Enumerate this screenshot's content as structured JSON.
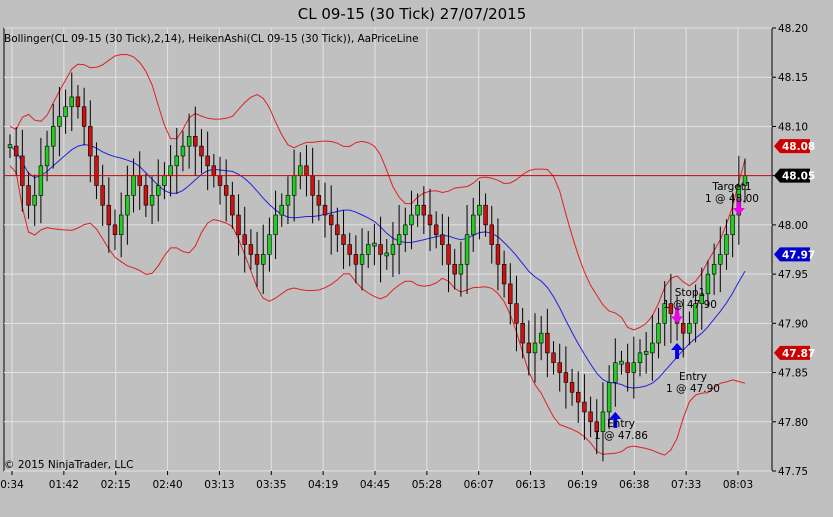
{
  "chart_data": {
    "type": "candlestick",
    "title": "CL 09-15 (30 Tick)  27/07/2015",
    "indicator_label": "Bollinger(CL 09-15 (30 Tick),2,14), HeikenAshi(CL 09-15 (30 Tick)), AaPriceLine",
    "copyright": "© 2015 NinjaTrader, LLC",
    "ylim": [
      47.75,
      48.2
    ],
    "y_ticks": [
      "48.20",
      "48.15",
      "48.10",
      "48.05",
      "48.00",
      "47.95",
      "47.90",
      "47.85",
      "47.80",
      "47.75"
    ],
    "x_ticks": [
      "0:34",
      "01:42",
      "02:15",
      "02:40",
      "03:13",
      "03:35",
      "04:19",
      "04:45",
      "05:28",
      "06:07",
      "06:13",
      "06:19",
      "06:38",
      "07:33",
      "08:03"
    ],
    "grid": true,
    "colors": {
      "up": "#22cc22",
      "down": "#cc1111",
      "band": "#dd2222",
      "mid": "#2222dd",
      "price_line": "#cc0000",
      "background": "#c0c0c0"
    },
    "price_tags": [
      {
        "value": 48.08,
        "label": "48.08",
        "color": "#cc0000"
      },
      {
        "value": 48.05,
        "label": "48.05",
        "color": "#000000"
      },
      {
        "value": 47.97,
        "label": "47.97",
        "color": "#0000cc"
      },
      {
        "value": 47.87,
        "label": "47.87",
        "color": "#cc0000"
      }
    ],
    "price_line": 48.05,
    "annotations": [
      {
        "label": "Target1",
        "qty": "1 @ 48.00",
        "marker": "exit-arrow-down"
      },
      {
        "label": "Stop1",
        "qty": "1 @ 47.90",
        "marker": "exit-arrow-down"
      },
      {
        "label": "Entry",
        "qty": "1 @ 47.90",
        "marker": "entry-arrow-up"
      },
      {
        "label": "Entry",
        "qty": "1 @ 47.86",
        "marker": "entry-arrow-up"
      }
    ],
    "closes": [
      48.08,
      48.07,
      48.04,
      48.02,
      48.03,
      48.06,
      48.08,
      48.1,
      48.11,
      48.12,
      48.13,
      48.12,
      48.1,
      48.07,
      48.04,
      48.02,
      48.0,
      47.99,
      48.01,
      48.03,
      48.05,
      48.04,
      48.02,
      48.03,
      48.04,
      48.05,
      48.06,
      48.07,
      48.08,
      48.09,
      48.08,
      48.07,
      48.06,
      48.05,
      48.04,
      48.03,
      48.01,
      47.99,
      47.98,
      47.97,
      47.96,
      47.97,
      47.99,
      48.01,
      48.02,
      48.03,
      48.05,
      48.06,
      48.05,
      48.03,
      48.02,
      48.01,
      48.0,
      47.99,
      47.98,
      47.97,
      47.96,
      47.97,
      47.98,
      47.98,
      47.97,
      47.97,
      47.98,
      47.99,
      48.0,
      48.01,
      48.02,
      48.01,
      48.0,
      47.99,
      47.98,
      47.96,
      47.95,
      47.96,
      47.99,
      48.01,
      48.02,
      48.0,
      47.98,
      47.96,
      47.94,
      47.92,
      47.9,
      47.88,
      47.87,
      47.88,
      47.89,
      47.87,
      47.86,
      47.85,
      47.84,
      47.83,
      47.82,
      47.81,
      47.8,
      47.79,
      47.81,
      47.84,
      47.86,
      47.86,
      47.85,
      47.86,
      47.87,
      47.87,
      47.88,
      47.9,
      47.92,
      47.91,
      47.9,
      47.89,
      47.9,
      47.92,
      47.93,
      47.95,
      47.96,
      47.97,
      47.99,
      48.01,
      48.04,
      48.05
    ]
  }
}
